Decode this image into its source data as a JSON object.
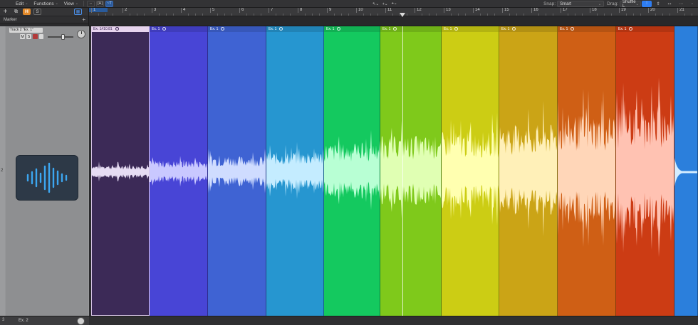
{
  "menubar": {
    "edit": "Edit",
    "functions": "Functions",
    "view": "View",
    "catch_glyph": "[H]",
    "flex_glyph": "~T",
    "snap_label": "Snap:",
    "snap_value": "Smart",
    "drag_label": "Drag:",
    "drag_value": "Shuffle L"
  },
  "header_tools": {
    "h_label": "H",
    "s_label": "S"
  },
  "marker_label": "Marker",
  "track": {
    "number": "2",
    "name": "Track 2 \"Ex. 1\"",
    "mute": "M",
    "solo": "S",
    "volume_level": 0.62
  },
  "bottom_track": {
    "number": "3",
    "name": "Ex. 2"
  },
  "ruler": {
    "bars": [
      "1",
      "2",
      "3",
      "4",
      "5",
      "6",
      "7",
      "8",
      "9",
      "10",
      "11",
      "12",
      "13",
      "14",
      "15",
      "16",
      "17",
      "18",
      "19",
      "20",
      "21"
    ]
  },
  "regions": [
    {
      "name": "Ex. 1#10.81",
      "color": "#3c2a57",
      "wave": "#e6dcf3",
      "amp": 0.05,
      "selected": true
    },
    {
      "name": "Ex. 1",
      "color": "#4845d6",
      "wave": "#c9c8ff",
      "amp": 0.08
    },
    {
      "name": "Ex. 1",
      "color": "#3f63d3",
      "wave": "#cfdcff",
      "amp": 0.11
    },
    {
      "name": "Ex. 1",
      "color": "#2696d0",
      "wave": "#c4ecff",
      "amp": 0.14
    },
    {
      "name": "Ex. 1",
      "color": "#14c95f",
      "wave": "#b8ffd4",
      "amp": 0.2
    },
    {
      "name": "Ex. 1",
      "color": "#7fc91b",
      "wave": "#e0ffb3",
      "amp": 0.25
    },
    {
      "name": "Ex. 1",
      "color": "#cccd14",
      "wave": "#ffffb0",
      "amp": 0.28
    },
    {
      "name": "Ex. 1",
      "color": "#cba416",
      "wave": "#fff0b8",
      "amp": 0.33
    },
    {
      "name": "Ex. 1",
      "color": "#cf5f15",
      "wave": "#ffd6b8",
      "amp": 0.4
    },
    {
      "name": "Ex. 1",
      "color": "#cc3c14",
      "wave": "#ffc2b2",
      "amp": 0.45
    },
    {
      "name": "",
      "color": "#2b7fdc",
      "wave": "#d4ecff",
      "amp": 0.0
    }
  ]
}
